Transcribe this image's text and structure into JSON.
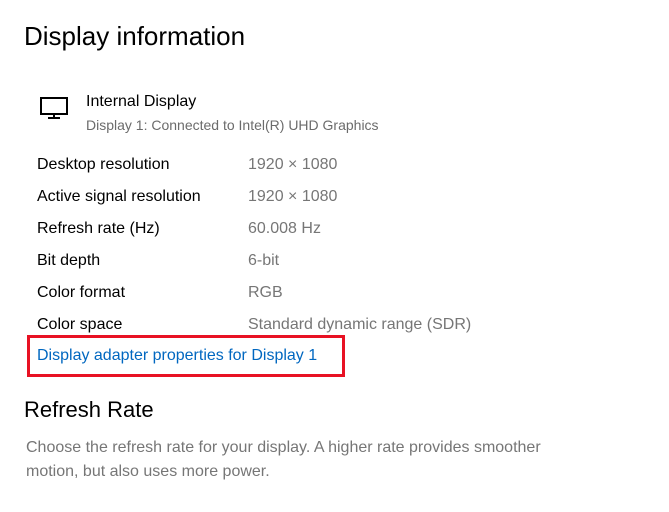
{
  "section": {
    "title": "Display information"
  },
  "display": {
    "icon": "monitor-icon",
    "name": "Internal Display",
    "subtitle": "Display 1: Connected to Intel(R) UHD Graphics"
  },
  "properties": [
    {
      "label": "Desktop resolution",
      "value": "1920 × 1080"
    },
    {
      "label": "Active signal resolution",
      "value": "1920 × 1080"
    },
    {
      "label": "Refresh rate (Hz)",
      "value": "60.008 Hz"
    },
    {
      "label": "Bit depth",
      "value": "6-bit"
    },
    {
      "label": "Color format",
      "value": "RGB"
    },
    {
      "label": "Color space",
      "value": "Standard dynamic range (SDR)"
    }
  ],
  "adapter_link": {
    "label": "Display adapter properties for Display 1",
    "highlight_color": "#e81123",
    "link_color": "#0067c0"
  },
  "refresh_rate": {
    "title": "Refresh Rate",
    "description": "Choose the refresh rate for your display. A higher rate provides smoother motion, but also uses more power."
  }
}
